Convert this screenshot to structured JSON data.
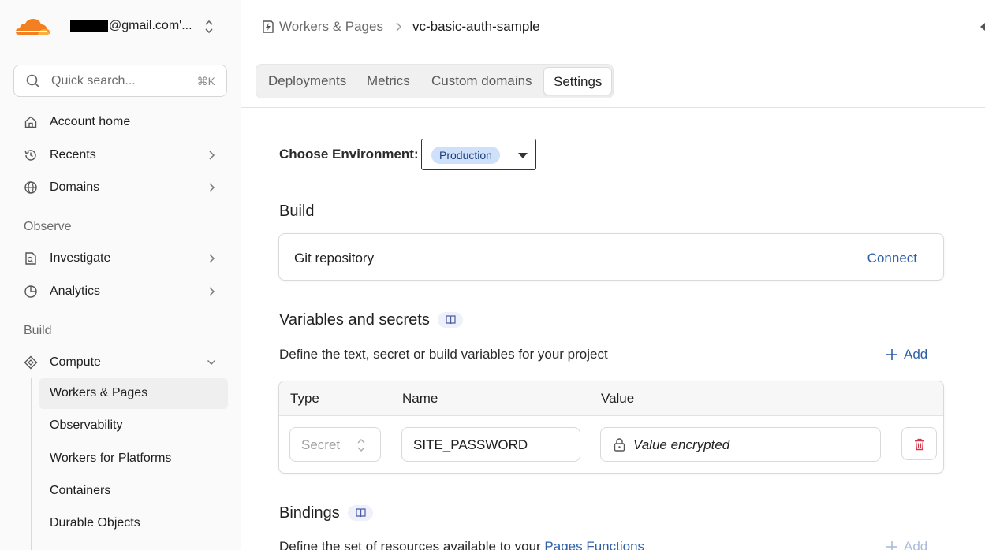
{
  "sidebar": {
    "account": "@gmail.com'...",
    "search": {
      "placeholder": "Quick search...",
      "shortcut": "⌘K"
    },
    "items": [
      {
        "label": "Account home",
        "icon": "home-icon"
      },
      {
        "label": "Recents",
        "icon": "history-icon"
      },
      {
        "label": "Domains",
        "icon": "globe-icon"
      }
    ],
    "observe_label": "Observe",
    "observe_items": [
      {
        "label": "Investigate",
        "icon": "investigate-icon"
      },
      {
        "label": "Analytics",
        "icon": "analytics-icon"
      }
    ],
    "build_label": "Build",
    "build_items": [
      {
        "label": "Compute",
        "icon": "compute-icon"
      }
    ],
    "compute_subitems": [
      {
        "label": "Workers & Pages",
        "active": true
      },
      {
        "label": "Observability"
      },
      {
        "label": "Workers for Platforms"
      },
      {
        "label": "Containers"
      },
      {
        "label": "Durable Objects"
      }
    ]
  },
  "header": {
    "breadcrumb_parent": "Workers & Pages",
    "breadcrumb_current": "vc-basic-auth-sample"
  },
  "tabs": [
    "Deployments",
    "Metrics",
    "Custom domains",
    "Settings"
  ],
  "active_tab": "Settings",
  "content": {
    "env_label": "Choose Environment:",
    "env_value": "Production",
    "build_heading": "Build",
    "git_repo_label": "Git repository",
    "connect_label": "Connect",
    "vars_heading": "Variables and secrets",
    "vars_desc": "Define the text, secret or build variables for your project",
    "add_label": "Add",
    "table_headers": {
      "type": "Type",
      "name": "Name",
      "value": "Value"
    },
    "row": {
      "type": "Secret",
      "name": "SITE_PASSWORD",
      "value": "Value encrypted"
    },
    "bindings_heading": "Bindings",
    "bindings_desc_prefix": "Define the set of resources available to your ",
    "bindings_desc_link": "Pages Functions",
    "bindings_add_label": "Add"
  },
  "colors": {
    "brand_orange": "#f38020",
    "link_blue": "#2f5fa7",
    "pill_bg": "#cfe0fb",
    "delete_red": "#d9344a"
  }
}
